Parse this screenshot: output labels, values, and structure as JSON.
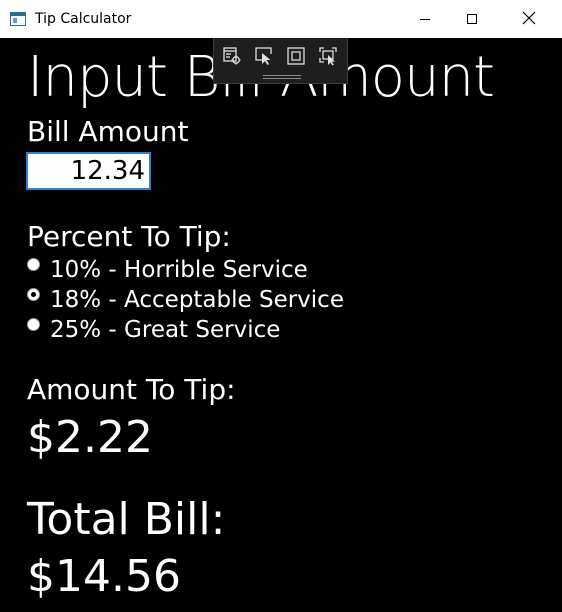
{
  "window": {
    "title": "Tip Calculator"
  },
  "titlebar_icons": {
    "app": "app-window-icon",
    "minimize": "minimize-icon",
    "maximize": "maximize-icon",
    "close": "close-icon"
  },
  "debug_toolbar": {
    "buttons": [
      "live-visual-tree-icon",
      "select-element-icon",
      "display-layout-adorners-icon",
      "track-focused-element-icon"
    ]
  },
  "page": {
    "title": "Input Bill Amount"
  },
  "bill": {
    "label": "Bill Amount",
    "value": "12.34"
  },
  "percent": {
    "label": "Percent To Tip:",
    "options": [
      {
        "label": "10% - Horrible Service",
        "checked": false
      },
      {
        "label": "18% - Acceptable Service",
        "checked": true
      },
      {
        "label": "25% - Great Service",
        "checked": false
      }
    ]
  },
  "tip": {
    "label": "Amount To Tip:",
    "value": "$2.22"
  },
  "total": {
    "label": "Total Bill:",
    "value": "$14.56"
  },
  "colors": {
    "background": "#000000",
    "foreground": "#ffffff",
    "input_border": "#2f7fd3",
    "toolbar": "#1e1e1e"
  }
}
